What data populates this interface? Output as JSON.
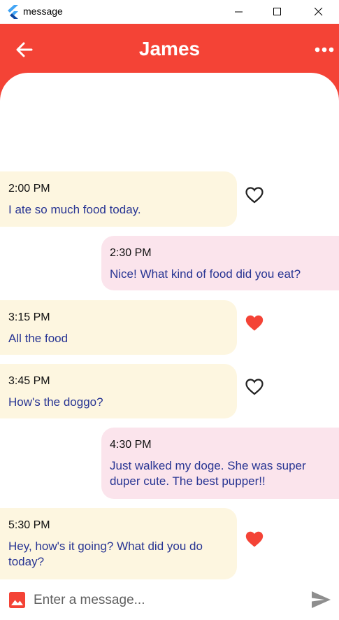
{
  "window": {
    "title": "message"
  },
  "header": {
    "contact_name": "James",
    "back_icon": "arrow-back-icon",
    "menu_icon": "more-horiz-icon",
    "color": "#f44336"
  },
  "messages": [
    {
      "time": "2:00 PM",
      "text": "I ate so much food today.",
      "direction": "received",
      "liked": false
    },
    {
      "time": "2:30 PM",
      "text": "Nice! What kind of food did you eat?",
      "direction": "sent"
    },
    {
      "time": "3:15 PM",
      "text": "All the food",
      "direction": "received",
      "liked": true
    },
    {
      "time": "3:45 PM",
      "text": "How's the doggo?",
      "direction": "received",
      "liked": false
    },
    {
      "time": "4:30 PM",
      "text": "Just walked my doge. She was super duper cute. The best pupper!!",
      "direction": "sent"
    },
    {
      "time": "5:30 PM",
      "text": "Hey, how's it going? What did you do today?",
      "direction": "received",
      "liked": true
    }
  ],
  "composer": {
    "placeholder": "Enter a message...",
    "value": "",
    "photo_icon": "photo-icon",
    "send_icon": "send-icon"
  },
  "colors": {
    "received_bubble": "#fdf6e0",
    "sent_bubble": "#fbe4ec",
    "message_text": "#283593",
    "like_active": "#f44336"
  }
}
